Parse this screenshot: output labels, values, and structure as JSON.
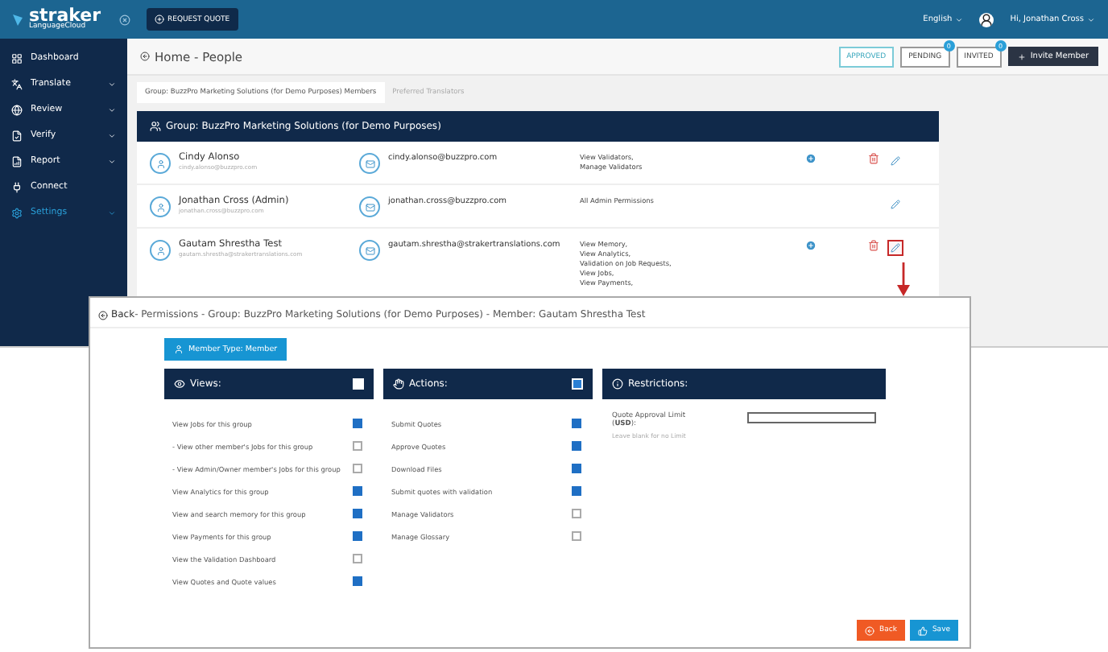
{
  "top_bar": {
    "logo": "straker",
    "logo_sub": "LanguageCloud",
    "request_quote": "REQUEST QUOTE",
    "language": "English",
    "user": "Hi, Jonathan Cross"
  },
  "sidebar": {
    "items": [
      {
        "label": "Dashboard",
        "expandable": false,
        "selected": false
      },
      {
        "label": "Translate",
        "expandable": true,
        "selected": false
      },
      {
        "label": "Review",
        "expandable": true,
        "selected": false
      },
      {
        "label": "Verify",
        "expandable": true,
        "selected": false
      },
      {
        "label": "Report",
        "expandable": true,
        "selected": false
      },
      {
        "label": "Connect",
        "expandable": false,
        "selected": false
      },
      {
        "label": "Settings",
        "expandable": true,
        "selected": true
      }
    ]
  },
  "page": {
    "title": "Home - People",
    "filters": [
      {
        "label": "APPROVED",
        "selected": true
      },
      {
        "label": "PENDING",
        "selected": false,
        "badge": "0"
      },
      {
        "label": "INVITED",
        "selected": false,
        "badge": "0"
      }
    ],
    "invite_button": "Invite Member"
  },
  "tabs": [
    {
      "label": "Group: BuzzPro Marketing Solutions (for Demo Purposes) Members",
      "selected": true
    },
    {
      "label": "Preferred Translators",
      "selected": false
    }
  ],
  "group_card": {
    "title": "Group: BuzzPro Marketing Solutions (for Demo Purposes)",
    "members": [
      {
        "name": "Cindy Alonso",
        "username": "cindy.alonso@buzzpro.com",
        "email": "cindy.alonso@buzzpro.com",
        "permissions": [
          "View Validators,",
          "Manage Validators"
        ],
        "can_add": true,
        "can_delete": true,
        "edit_highlighted": false
      },
      {
        "name": "Jonathan Cross (Admin)",
        "username": "jonathan.cross@buzzpro.com",
        "email": "jonathan.cross@buzzpro.com",
        "permissions": [
          "All Admin Permissions"
        ],
        "can_add": false,
        "can_delete": false,
        "edit_highlighted": false
      },
      {
        "name": "Gautam Shrestha Test",
        "username": "gautam.shrestha@strakertranslations.com",
        "email": "gautam.shrestha@strakertranslations.com",
        "permissions": [
          "View Memory,",
          "View Analytics,",
          "Validation on Job Requests,",
          "View Jobs,",
          "View Payments,"
        ],
        "can_add": true,
        "can_delete": true,
        "edit_highlighted": true
      }
    ]
  },
  "permissions_dialog": {
    "back_link": "Back",
    "breadcrumb": " - Permissions - Group: BuzzPro Marketing Solutions (for Demo Purposes) - Member: Gautam Shrestha Test",
    "member_type_button": "Member Type: Member",
    "views": {
      "title": "Views:",
      "checked": false,
      "items": [
        {
          "label": "View Jobs for this group",
          "checked": true
        },
        {
          "label": "- View other member's Jobs for this group",
          "checked": false
        },
        {
          "label": "- View Admin/Owner member's Jobs for this group",
          "checked": false
        },
        {
          "label": "View Analytics for this group",
          "checked": true
        },
        {
          "label": "View and search memory for this group",
          "checked": true
        },
        {
          "label": "View Payments for this group",
          "checked": true
        },
        {
          "label": "View the Validation Dashboard",
          "checked": false
        },
        {
          "label": "View Quotes and Quote values",
          "checked": true
        }
      ]
    },
    "actions": {
      "title": "Actions:",
      "checked": true,
      "items": [
        {
          "label": "Submit Quotes",
          "checked": true
        },
        {
          "label": "Approve Quotes",
          "checked": true
        },
        {
          "label": "Download Files",
          "checked": true
        },
        {
          "label": "Submit quotes with validation",
          "checked": true
        },
        {
          "label": "Manage Validators",
          "checked": false
        },
        {
          "label": "Manage Glossary",
          "checked": false
        }
      ]
    },
    "restrictions": {
      "title": "Restrictions:",
      "limit_label": "Quote Approval Limit (**USD**):",
      "limit_hint": "Leave blank for no Limit"
    },
    "back_button": "Back",
    "save_button": "Save"
  }
}
